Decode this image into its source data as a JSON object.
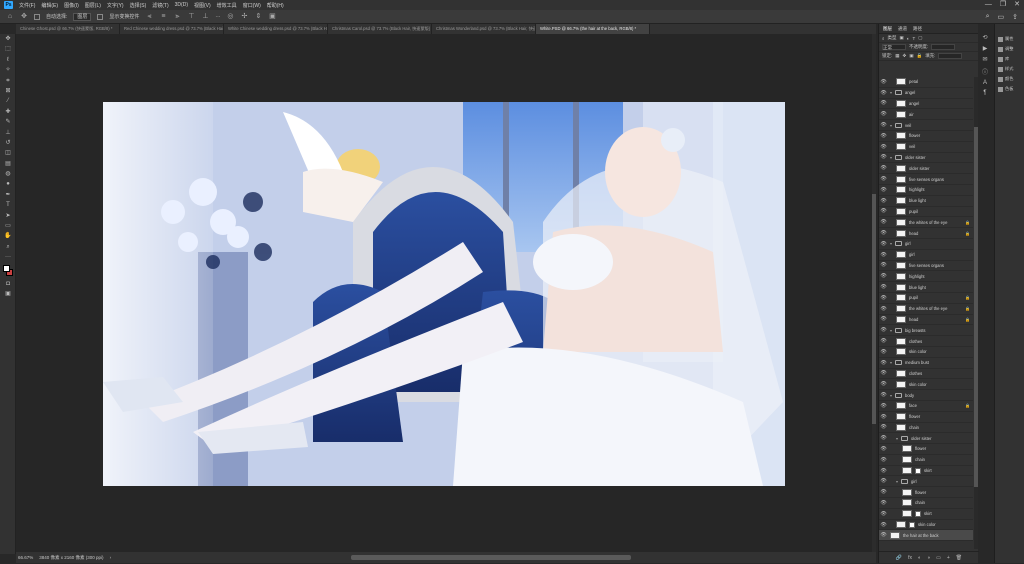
{
  "menubar": {
    "logo": "Ps",
    "items": [
      "文件(F)",
      "编辑(E)",
      "图像(I)",
      "图层(L)",
      "文字(Y)",
      "选择(S)",
      "滤镜(T)",
      "3D(D)",
      "视图(V)",
      "增效工具",
      "窗口(W)",
      "帮助(H)"
    ],
    "window_controls": [
      "—",
      "❐",
      "✕"
    ]
  },
  "options": {
    "auto_select_label": "自动选择:",
    "auto_select_value": "图层",
    "transform_label": "显示变换控件",
    "more": "···"
  },
  "tabs": [
    {
      "label": "Chinese Ghost.psd @ 66.7% (快速蒙版, RGB/8) *"
    },
    {
      "label": "Red Chinese wedding dress.psd @ 73.7% (Black Hair, 快速蒙版) *"
    },
    {
      "label": "White Chinese wedding dress.psd @ 73.7% (Black Hair, 快速蒙版) *"
    },
    {
      "label": "Christmas Carol.psd @ 73.7% (Black Hair, 快速蒙版) *"
    },
    {
      "label": "Christmas Wonderland.psd @ 73.7% (Black Hair, 快速蒙版) *"
    },
    {
      "label": "White.PSD @ 66.7% (the hair at the back, RGB/8) *"
    }
  ],
  "status": {
    "zoom": "66.67%",
    "doc_info": "3840 像素 x 2160 像素 (300 ppi)"
  },
  "layers_panel": {
    "tabs": [
      "图层",
      "通道",
      "路径"
    ],
    "kind_label": "类型",
    "blend_mode": "正常",
    "opacity_label": "不透明度:",
    "lock_label": "锁定:",
    "fill_label": "填充:",
    "layers": [
      {
        "name": "petal",
        "type": "layer",
        "indent": 1
      },
      {
        "name": "angel",
        "type": "group",
        "indent": 0
      },
      {
        "name": "angel",
        "type": "layer",
        "indent": 1
      },
      {
        "name": "air",
        "type": "layer",
        "indent": 1
      },
      {
        "name": "veil",
        "type": "group",
        "indent": 0
      },
      {
        "name": "flower",
        "type": "layer",
        "indent": 1
      },
      {
        "name": "veil",
        "type": "layer",
        "indent": 1
      },
      {
        "name": "older sister",
        "type": "group",
        "indent": 0
      },
      {
        "name": "older sister",
        "type": "layer",
        "indent": 1
      },
      {
        "name": "five senses organs",
        "type": "layer",
        "indent": 1
      },
      {
        "name": "highlight",
        "type": "layer",
        "indent": 1
      },
      {
        "name": "blue light",
        "type": "layer",
        "indent": 1
      },
      {
        "name": "pupil",
        "type": "layer",
        "indent": 1
      },
      {
        "name": "the whites of the eye",
        "type": "layer",
        "indent": 1,
        "locked": true
      },
      {
        "name": "head",
        "type": "layer",
        "indent": 1,
        "locked": true
      },
      {
        "name": "girl",
        "type": "group",
        "indent": 0
      },
      {
        "name": "girl",
        "type": "layer",
        "indent": 1
      },
      {
        "name": "five senses organs",
        "type": "layer",
        "indent": 1
      },
      {
        "name": "highlight",
        "type": "layer",
        "indent": 1
      },
      {
        "name": "blue light",
        "type": "layer",
        "indent": 1
      },
      {
        "name": "pupil",
        "type": "layer",
        "indent": 1,
        "locked": true
      },
      {
        "name": "the whites of the eye",
        "type": "layer",
        "indent": 1,
        "locked": true
      },
      {
        "name": "head",
        "type": "layer",
        "indent": 1,
        "locked": true
      },
      {
        "name": "big breasts",
        "type": "group",
        "indent": 0
      },
      {
        "name": "clothes",
        "type": "layer",
        "indent": 1
      },
      {
        "name": "skin color",
        "type": "layer",
        "indent": 1
      },
      {
        "name": "medium bust",
        "type": "group",
        "indent": 0
      },
      {
        "name": "clothes",
        "type": "layer",
        "indent": 1
      },
      {
        "name": "skin color",
        "type": "layer",
        "indent": 1
      },
      {
        "name": "body",
        "type": "group",
        "indent": 0
      },
      {
        "name": "face",
        "type": "layer",
        "indent": 1,
        "locked": true
      },
      {
        "name": "flower",
        "type": "layer",
        "indent": 1
      },
      {
        "name": "chain",
        "type": "layer",
        "indent": 1
      },
      {
        "name": "older sister",
        "type": "group",
        "indent": 1
      },
      {
        "name": "flower",
        "type": "layer",
        "indent": 2
      },
      {
        "name": "chain",
        "type": "layer",
        "indent": 2
      },
      {
        "name": "skirt",
        "type": "masked",
        "indent": 2
      },
      {
        "name": "girl",
        "type": "group",
        "indent": 1
      },
      {
        "name": "flower",
        "type": "layer",
        "indent": 2
      },
      {
        "name": "chain",
        "type": "layer",
        "indent": 2
      },
      {
        "name": "skirt",
        "type": "masked",
        "indent": 2
      },
      {
        "name": "skin color",
        "type": "masked",
        "indent": 1
      },
      {
        "name": "the hair at the back",
        "type": "layer",
        "indent": 0,
        "selected": true
      }
    ],
    "bottom_icons": [
      "🔗",
      "fx",
      "◐",
      "◑",
      "▭",
      "+",
      "🗑"
    ]
  },
  "right_panel": {
    "items": [
      "属性",
      "调整",
      "库",
      "样式",
      "颜色",
      "色板"
    ]
  },
  "colors": {
    "foreground": "#ffffff",
    "background": "#c84040",
    "accent": "#31a8ff"
  }
}
